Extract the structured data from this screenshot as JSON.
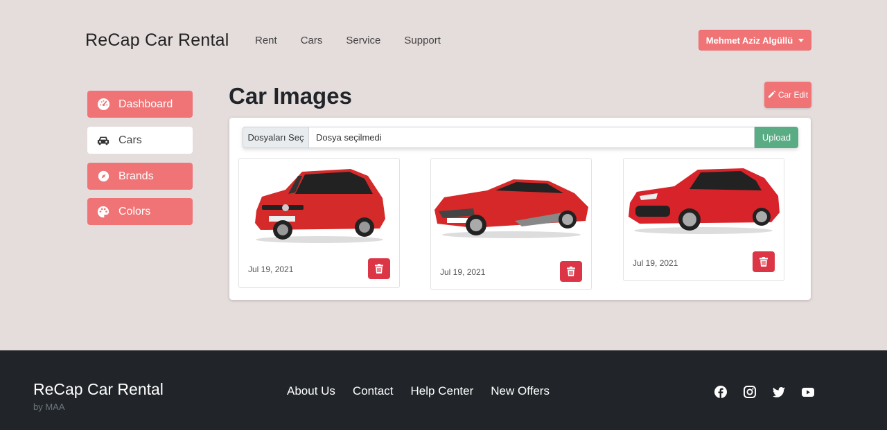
{
  "header": {
    "brand": "ReCap Car Rental",
    "nav": [
      "Rent",
      "Cars",
      "Service",
      "Support"
    ],
    "user": "Mehmet Aziz Algüllü"
  },
  "sidebar": {
    "items": [
      {
        "label": "Dashboard",
        "icon": "dashboard-gauge-icon"
      },
      {
        "label": "Cars",
        "icon": "car-icon"
      },
      {
        "label": "Brands",
        "icon": "compass-icon"
      },
      {
        "label": "Colors",
        "icon": "palette-icon"
      }
    ]
  },
  "main": {
    "title": "Car Images",
    "edit_label": "Car Edit",
    "file_choose_label": "Dosyaları Seç",
    "file_status": "Dosya seçilmedi",
    "upload_label": "Upload",
    "cards": [
      {
        "date": "Jul 19, 2021"
      },
      {
        "date": "Jul 19, 2021"
      },
      {
        "date": "Jul 19, 2021"
      }
    ]
  },
  "footer": {
    "brand": "ReCap Car Rental",
    "by": "by MAA",
    "links": [
      "About Us",
      "Contact",
      "Help Center",
      "New Offers"
    ],
    "social": [
      "facebook-icon",
      "instagram-icon",
      "twitter-icon",
      "youtube-icon"
    ]
  },
  "colors": {
    "accent": "#f07476",
    "danger": "#dc3545",
    "success": "#5aac84",
    "background": "#e5dcdc",
    "footer": "#212529"
  }
}
